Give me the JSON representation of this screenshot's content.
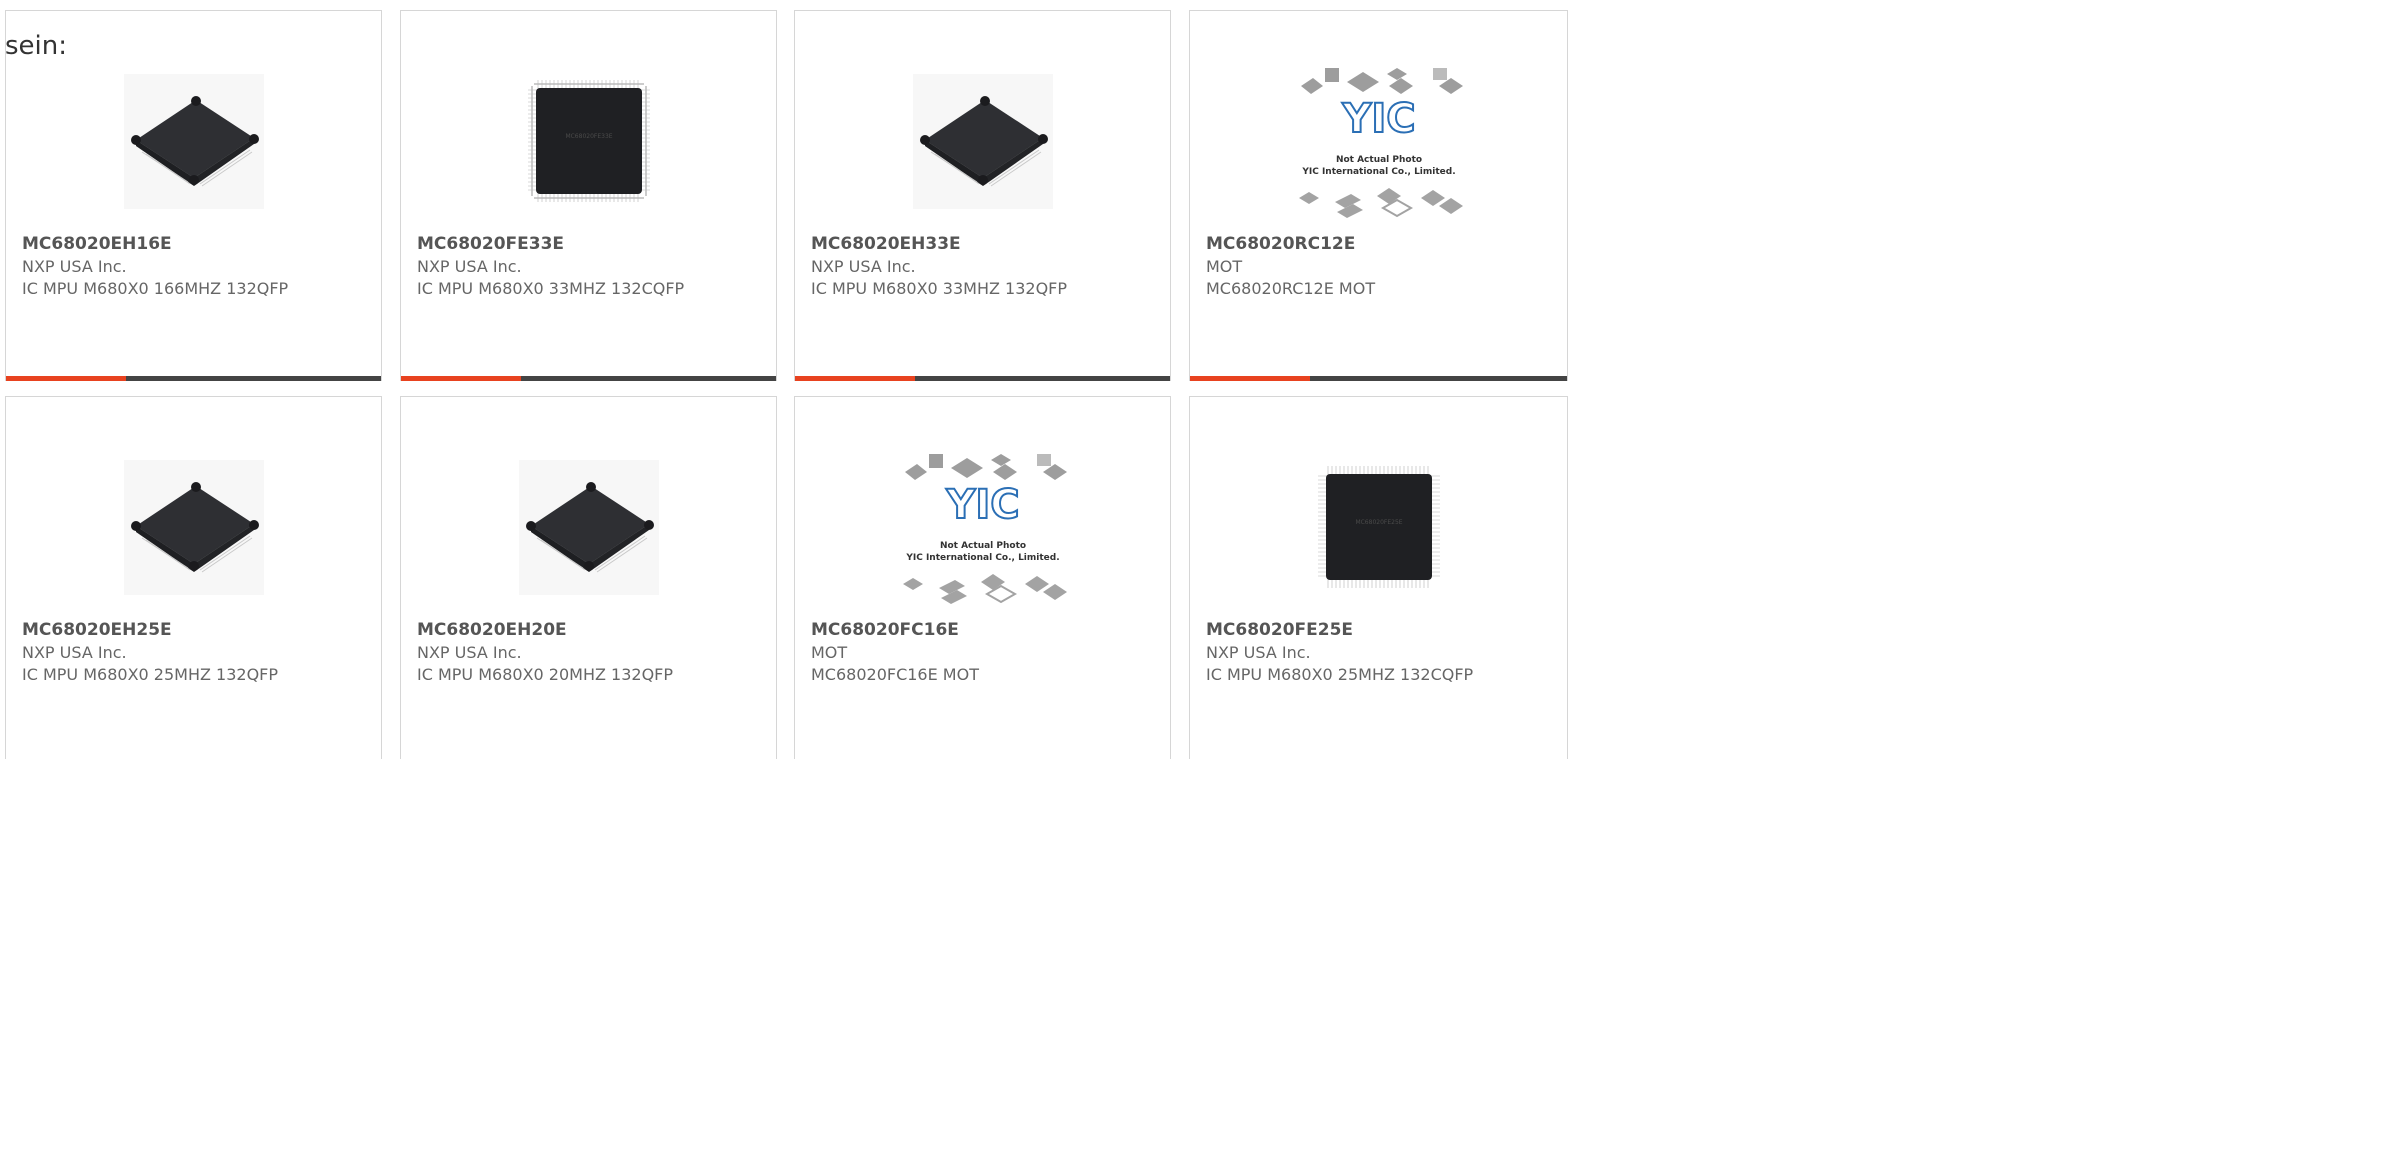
{
  "intro_text": "sein:",
  "colors": {
    "accent": "#e8421f",
    "bar": "#444444",
    "border": "#d6d6d6"
  },
  "products": [
    {
      "part_number": "MC68020EH16E",
      "manufacturer": "NXP USA Inc.",
      "description": "IC MPU M680X0 166MHZ 132QFP",
      "image": "qfp-chip-angled-icon"
    },
    {
      "part_number": "MC68020FE33E",
      "manufacturer": "NXP USA Inc.",
      "description": "IC MPU M680X0 33MHZ 132CQFP",
      "image": "cqfp-chip-top-icon"
    },
    {
      "part_number": "MC68020EH33E",
      "manufacturer": "NXP USA Inc.",
      "description": "IC MPU M680X0 33MHZ 132QFP",
      "image": "qfp-chip-angled-icon"
    },
    {
      "part_number": "MC68020RC12E",
      "manufacturer": "MOT",
      "description": "MC68020RC12E MOT",
      "image": "yic-placeholder-icon",
      "placeholder_line1": "Not Actual Photo",
      "placeholder_line2": "YIC International Co., Limited."
    },
    {
      "part_number": "MC68020EH25E",
      "manufacturer": "NXP USA Inc.",
      "description": "IC MPU M680X0 25MHZ 132QFP",
      "image": "qfp-chip-angled-icon"
    },
    {
      "part_number": "MC68020EH20E",
      "manufacturer": "NXP USA Inc.",
      "description": "IC MPU M680X0 20MHZ 132QFP",
      "image": "qfp-chip-angled-icon"
    },
    {
      "part_number": "MC68020FC16E",
      "manufacturer": "MOT",
      "description": "MC68020FC16E MOT",
      "image": "yic-placeholder-icon",
      "placeholder_line1": "Not Actual Photo",
      "placeholder_line2": "YIC International Co., Limited."
    },
    {
      "part_number": "MC68020FE25E",
      "manufacturer": "NXP USA Inc.",
      "description": "IC MPU M680X0 25MHZ 132CQFP",
      "image": "cqfp-chip-top-icon"
    }
  ]
}
